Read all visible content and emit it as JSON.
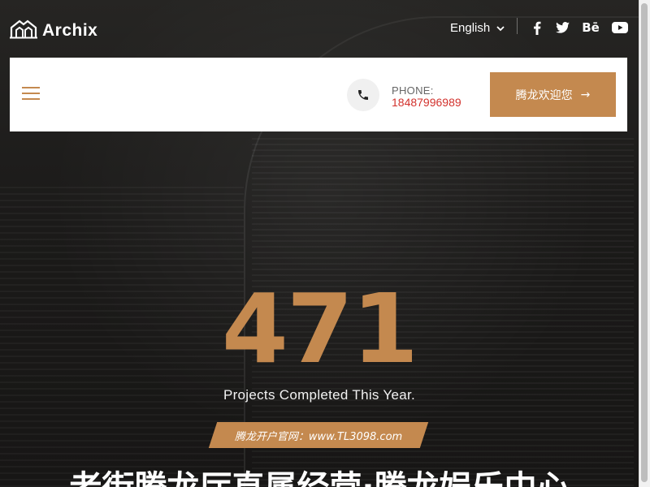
{
  "brand": {
    "name": "Archix"
  },
  "topbar": {
    "language": "English",
    "social_icons": [
      "facebook-icon",
      "twitter-icon",
      "behance-icon",
      "youtube-icon"
    ],
    "behance_glyph": "Bē"
  },
  "navbar": {
    "phone_label": "PHONE:",
    "phone_number": "18487996989",
    "cta_label": "腾龙欢迎您",
    "cta_arrow": "→"
  },
  "hero": {
    "counter": "471",
    "caption": "Projects Completed This Year.",
    "site_tag": "腾龙开户官网：www.TL3098.com",
    "headline": "老街腾龙厅直属经营·腾龙娱乐中心"
  },
  "colors": {
    "accent": "#c4894f",
    "phone_number": "#d2322d",
    "navbar_bg": "#ffffff",
    "hero_bg": "#1c1b1a"
  }
}
